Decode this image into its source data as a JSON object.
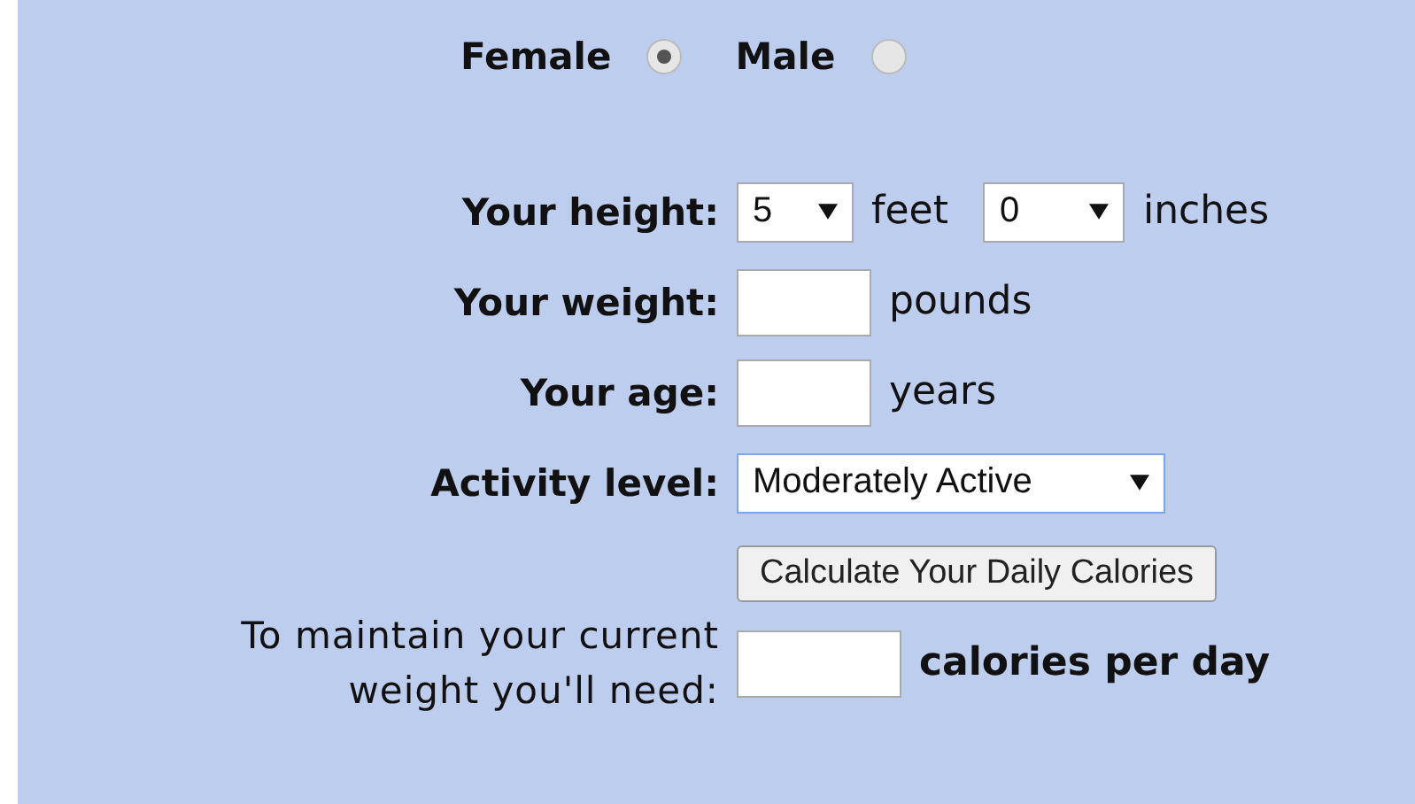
{
  "gender": [
    {
      "label": "Female",
      "selected": true
    },
    {
      "label": "Male",
      "selected": false
    }
  ],
  "rows": [
    {
      "kind": "selects",
      "label": "Your height:",
      "selects": [
        {
          "value": "5",
          "unit": "feet"
        },
        {
          "value": "0",
          "unit": "inches"
        }
      ]
    },
    {
      "kind": "input",
      "label": "Your weight:",
      "unit": "pounds"
    },
    {
      "kind": "input",
      "label": "Your age:",
      "unit": "years"
    },
    {
      "kind": "select",
      "label": "Activity level:",
      "value": "Moderately Active"
    }
  ],
  "calculate_button": "Calculate Your Daily Calories",
  "result": {
    "label": "To maintain your current weight you'll need:",
    "unit": "calories per day"
  }
}
